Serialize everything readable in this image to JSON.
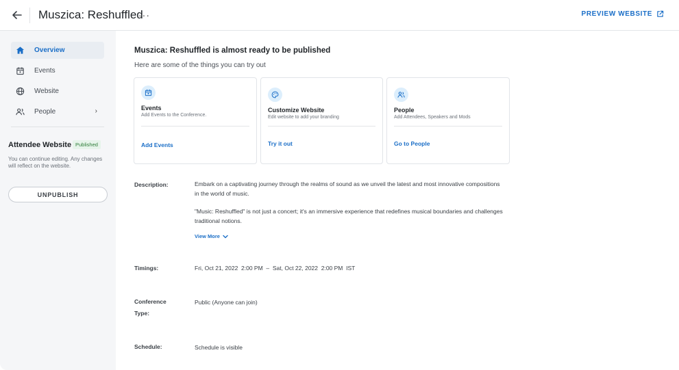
{
  "header": {
    "title": "Muszica: Reshuffled",
    "more_label": "···",
    "preview_label": "PREVIEW WEBSITE"
  },
  "sidebar": {
    "items": [
      {
        "label": "Overview",
        "icon": "home-icon",
        "active": true
      },
      {
        "label": "Events",
        "icon": "calendar-icon"
      },
      {
        "label": "Website",
        "icon": "globe-icon"
      },
      {
        "label": "People",
        "icon": "people-icon",
        "has_chevron": true
      }
    ],
    "chevron": "›",
    "attendee_website": {
      "title": "Attendee Website",
      "badge": "Published",
      "description": "You can continue editing. Any changes will reflect on the website.",
      "unpublish_label": "UNPUBLISH"
    }
  },
  "main": {
    "title": "Muszica: Reshuffled is almost ready to be published",
    "subtitle": "Here are some of the things you can try out",
    "cards": [
      {
        "title": "Events",
        "description": "Add Events to the Conference.",
        "link": "Add Events",
        "icon": "calendar-icon"
      },
      {
        "title": "Customize Website",
        "description": "Edit website to add your branding",
        "link": "Try it out",
        "icon": "palette-icon"
      },
      {
        "title": "People",
        "description": "Add Attendees, Speakers and Mods",
        "link": "Go to People",
        "icon": "people-icon"
      }
    ],
    "description": {
      "label": "Description:",
      "paragraph1": "Embark on a captivating journey through the realms of sound as we unveil the latest and most innovative compositions in the world of music.",
      "paragraph2": "\"Music: Reshuffled\" is not just a concert; it's an immersive experience that redefines musical boundaries and challenges traditional notions.",
      "view_more": "View More"
    },
    "timings": {
      "label": "Timings:",
      "value": "Fri, Oct 21, 2022  2:00 PM  –  Sat, Oct 22, 2022  2:00 PM  IST"
    },
    "conference_type": {
      "label": "Conference Type:",
      "value": "Public (Anyone can join)"
    },
    "schedule": {
      "label": "Schedule:",
      "value": "Schedule is visible"
    }
  },
  "colors": {
    "accent": "#1a6ec7",
    "sidebar_bg": "#f5f6f8",
    "badge_bg": "#e6f4ea",
    "badge_text": "#2f7d3a",
    "icon_circle": "#dceefc"
  }
}
